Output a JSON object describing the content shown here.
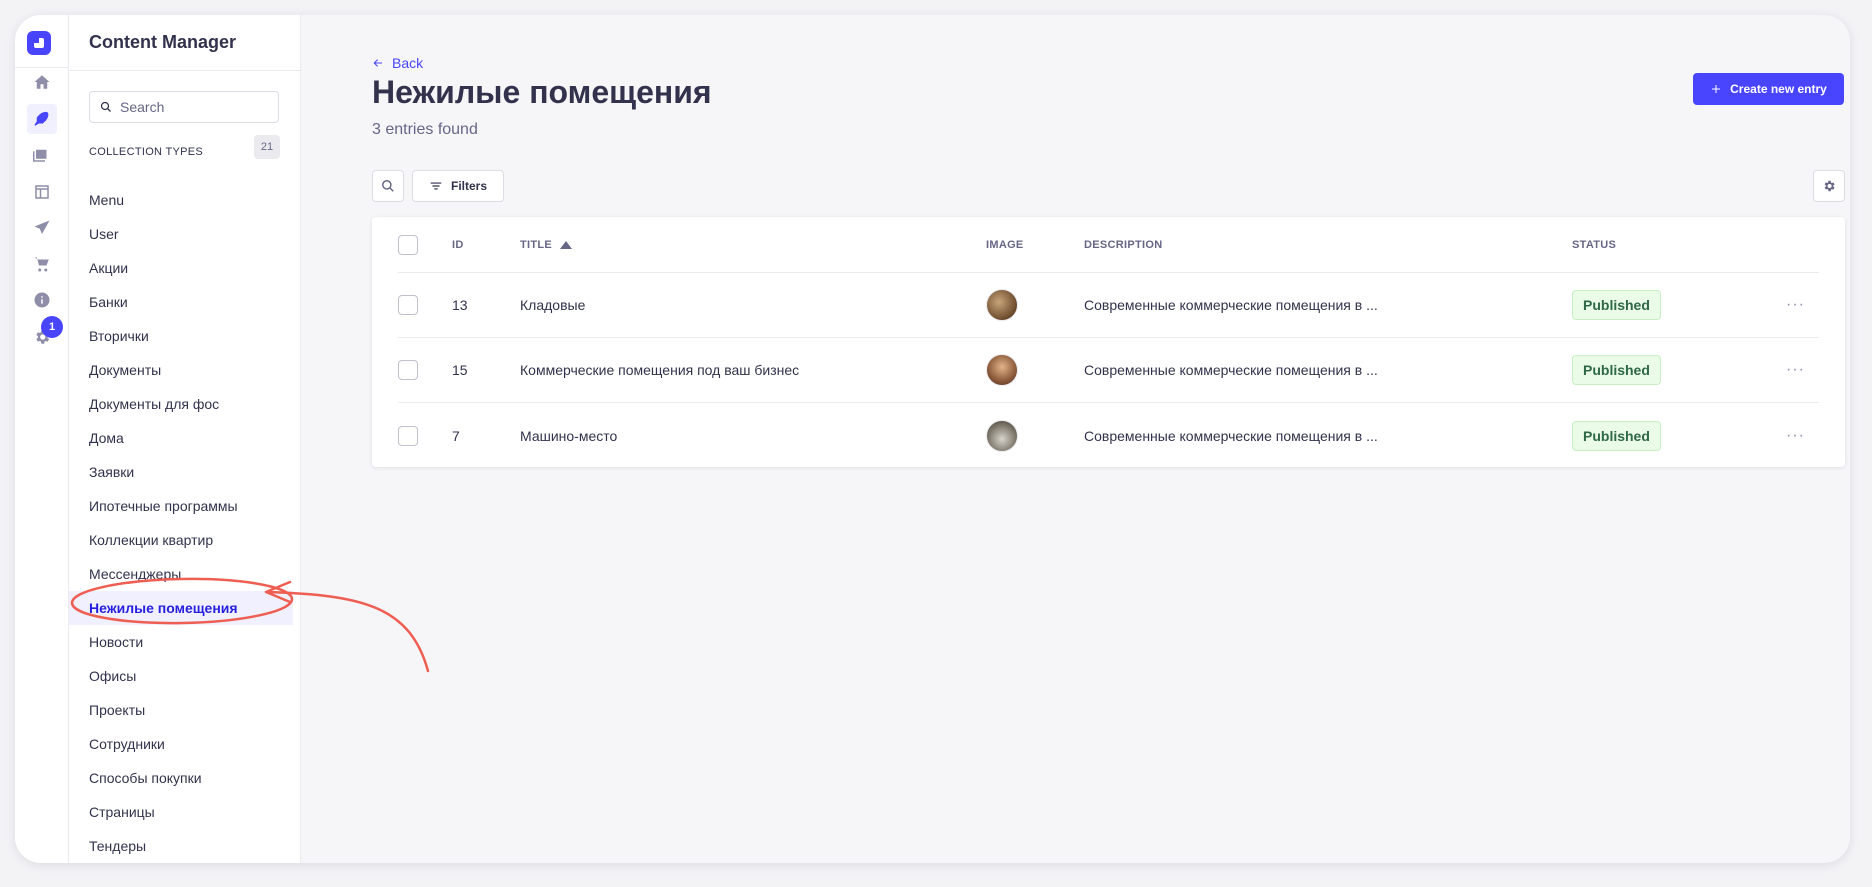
{
  "subnav": {
    "title": "Content Manager",
    "search_placeholder": "Search",
    "collection_types_label": "COLLECTION TYPES",
    "collection_types_count": "21",
    "items": [
      "Menu",
      "User",
      "Акции",
      "Банки",
      "Вторички",
      "Документы",
      "Документы для фос",
      "Дома",
      "Заявки",
      "Ипотечные программы",
      "Коллекции квартир",
      "Мессенджеры",
      "Нежилые помещения",
      "Новости",
      "Офисы",
      "Проекты",
      "Сотрудники",
      "Способы покупки",
      "Страницы",
      "Тендеры"
    ],
    "active_item": "Нежилые помещения"
  },
  "rail": {
    "icons": [
      "home-icon",
      "feather-icon",
      "media-library-icon",
      "layout-icon",
      "send-icon",
      "cart-icon",
      "info-icon",
      "settings-icon"
    ],
    "settings_badge": "1"
  },
  "header": {
    "back_label": "Back",
    "title": "Нежилые помещения",
    "subtitle": "3 entries found",
    "create_label": "Create new entry",
    "filters_label": "Filters"
  },
  "table": {
    "columns": {
      "id": "ID",
      "title": "TITLE",
      "image": "IMAGE",
      "description": "DESCRIPTION",
      "status": "STATUS"
    },
    "rows": [
      {
        "id": "13",
        "title": "Кладовые",
        "description": "Современные коммерческие помещения в ...",
        "status": "Published"
      },
      {
        "id": "15",
        "title": "Коммерческие помещения под ваш бизнес",
        "description": "Современные коммерческие помещения в ...",
        "status": "Published"
      },
      {
        "id": "7",
        "title": "Машино-место",
        "description": "Современные коммерческие помещения в ...",
        "status": "Published"
      }
    ],
    "more_label": "···"
  },
  "colors": {
    "primary": "#4945ff",
    "published_bg": "#eafbe7",
    "published_text": "#2f6846",
    "annotation": "#ee5e52"
  }
}
